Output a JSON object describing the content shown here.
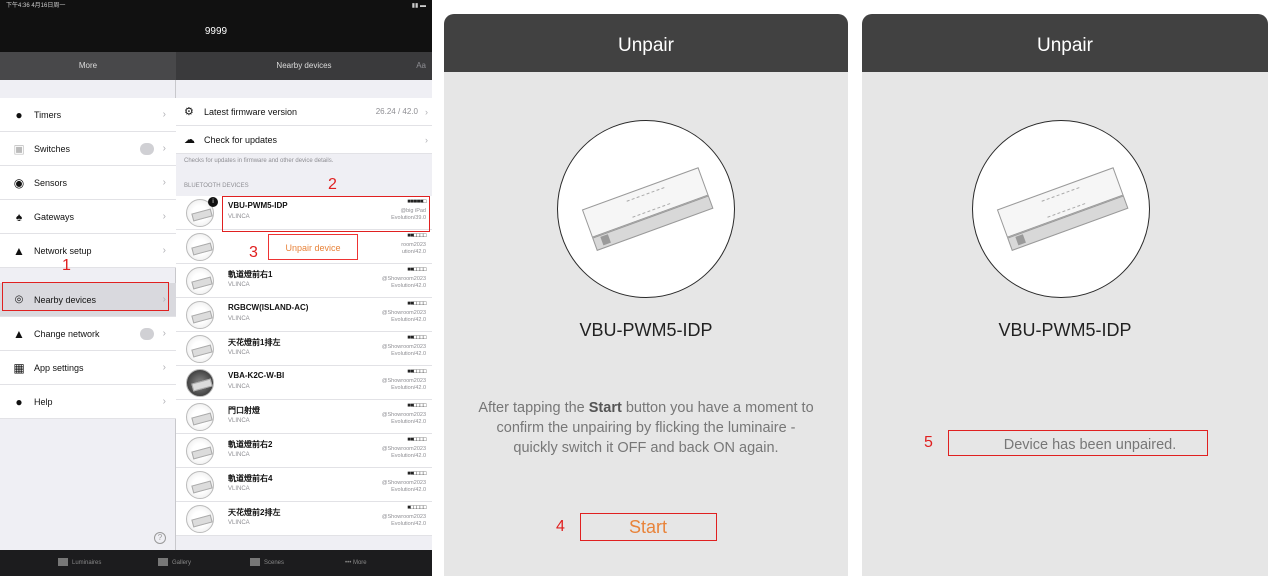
{
  "left_panel": {
    "status_left": "下午4:36 4月16日周一",
    "status_right": "",
    "title": "9999",
    "nav_left": "More",
    "nav_right": "Nearby devices",
    "nav_right_action": "Aa",
    "sidebar": [
      {
        "label": "Timers",
        "icon": "clock-icon"
      },
      {
        "label": "Switches",
        "icon": "switch-icon",
        "toggle": true
      },
      {
        "label": "Sensors",
        "icon": "sensor-icon"
      },
      {
        "label": "Gateways",
        "icon": "gateway-icon"
      },
      {
        "label": "Network setup",
        "icon": "network-icon"
      },
      {
        "label": "Nearby devices",
        "icon": "nearby-icon",
        "selected": true
      },
      {
        "label": "Change network",
        "icon": "network-icon",
        "toggle": true
      },
      {
        "label": "App settings",
        "icon": "settings-icon"
      },
      {
        "label": "Help",
        "icon": "help-icon"
      }
    ],
    "firmware": {
      "label": "Latest firmware version",
      "value": "26.24 / 42.0"
    },
    "updates": {
      "label": "Check for updates"
    },
    "caption": "Checks for updates in firmware and other device details.",
    "section_header": "BLUETOOTH DEVICES",
    "devices": [
      {
        "name": "VBU-PWM5-IDP",
        "vendor": "VLINCA",
        "signal": "■■■■■□",
        "info1": "@big iPad",
        "info2": "Evolution/39.0",
        "badge": "i"
      },
      {
        "name": "",
        "vendor": "",
        "signal": "■■□□□□",
        "info1": "room2023",
        "info2": "ution/42.0"
      },
      {
        "name": "軌道燈前右1",
        "vendor": "VLINCA",
        "signal": "■■□□□□",
        "info1": "@Showroom2023",
        "info2": "Evolution/42.0"
      },
      {
        "name": "RGBCW(ISLAND-AC)",
        "vendor": "VLINCA",
        "signal": "■■□□□□",
        "info1": "@Showroom2023",
        "info2": "Evolution/42.0"
      },
      {
        "name": "天花燈前1排左",
        "vendor": "VLINCA",
        "signal": "■■□□□□",
        "info1": "@Showroom2023",
        "info2": "Evolution/42.0"
      },
      {
        "name": "VBA-K2C-W-BI",
        "vendor": "VLINCA",
        "signal": "■■□□□□",
        "info1": "@Showroom2023",
        "info2": "Evolution/42.0"
      },
      {
        "name": "門口射燈",
        "vendor": "VLINCA",
        "signal": "■■□□□□",
        "info1": "@Showroom2023",
        "info2": "Evolution/42.0"
      },
      {
        "name": "軌道燈前右2",
        "vendor": "VLINCA",
        "signal": "■■□□□□",
        "info1": "@Showroom2023",
        "info2": "Evolution/42.0"
      },
      {
        "name": "軌道燈前右4",
        "vendor": "VLINCA",
        "signal": "■■□□□□",
        "info1": "@Showroom2023",
        "info2": "Evolution/42.0"
      },
      {
        "name": "天花燈前2排左",
        "vendor": "VLINCA",
        "signal": "■□□□□□",
        "info1": "@Showroom2023",
        "info2": "Evolution/42.0"
      }
    ],
    "unpair_label": "Unpair device",
    "tabs": [
      "Luminaires",
      "Gallery",
      "Scenes",
      "More"
    ]
  },
  "annotations": [
    "1",
    "2",
    "3",
    "4",
    "5"
  ],
  "middle_panel": {
    "title": "Unpair",
    "device_name": "VBU-PWM5-IDP",
    "instr_before": "After tapping the ",
    "instr_bold": "Start",
    "instr_after": " button you have a moment to confirm the unpairing by flicking the luminaire - quickly switch it OFF and back ON again.",
    "start_label": "Start"
  },
  "right_panel": {
    "title": "Unpair",
    "device_name": "VBU-PWM5-IDP",
    "status": "Device has been unpaired."
  },
  "colors": {
    "accent": "#e8833a",
    "annotation": "#e02020",
    "header": "#414141"
  }
}
